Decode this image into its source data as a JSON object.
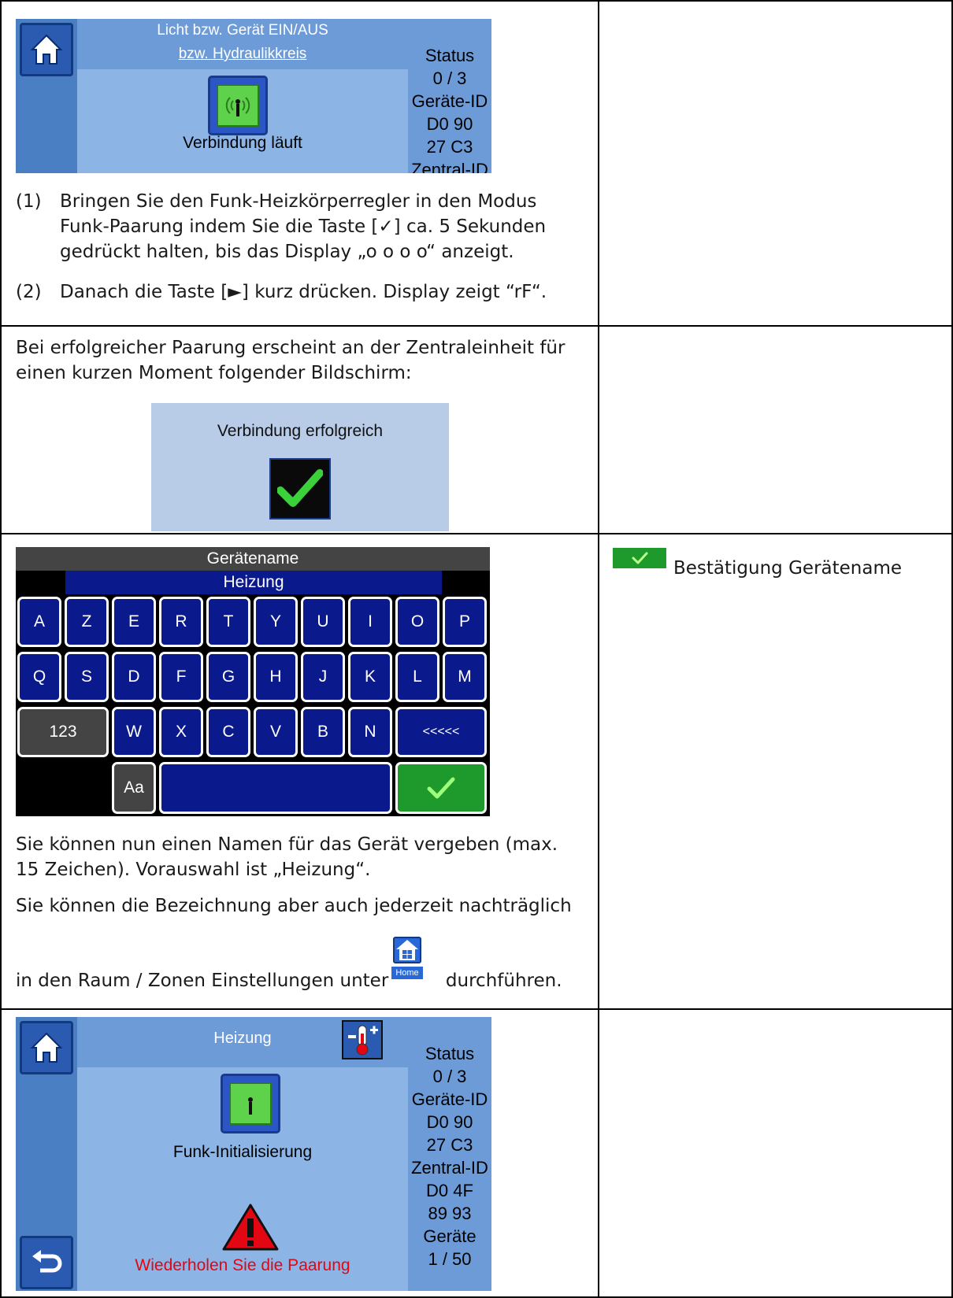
{
  "section1": {
    "screen": {
      "title_line1": "Licht bzw. Gerät EIN/AUS",
      "title_line2": "bzw. Hydraulikkreis",
      "connecting_label": "Verbindung läuft",
      "status_lines": [
        "Status",
        "0 / 3",
        "Geräte-ID",
        "D0 90",
        "27 C3",
        "Zentral-ID"
      ]
    },
    "steps": [
      {
        "num": "(1)",
        "lines": [
          "Bringen Sie den Funk-Heizkörperregler in den Modus",
          "Funk-Paarung indem Sie die Taste [✓] ca. 5 Sekunden",
          "gedrückt halten, bis das Display „o o o o“ anzeigt."
        ]
      },
      {
        "num": "(2)",
        "lines": [
          "Danach die Taste [►] kurz drücken. Display zeigt “rF“."
        ]
      }
    ]
  },
  "section2": {
    "text_lines": [
      "Bei erfolgreicher Paarung erscheint an der Zentraleinheit für",
      "einen kurzen Moment folgender Bildschirm:"
    ],
    "success_label": "Verbindung erfolgreich"
  },
  "section3": {
    "keyboard": {
      "title": "Gerätename",
      "name_value": "Heizung",
      "row1": [
        "A",
        "Z",
        "E",
        "R",
        "T",
        "Y",
        "U",
        "I",
        "O",
        "P"
      ],
      "row2": [
        "Q",
        "S",
        "D",
        "F",
        "G",
        "H",
        "J",
        "K",
        "L",
        "M"
      ],
      "row3": [
        "W",
        "X",
        "C",
        "V",
        "B",
        "N"
      ],
      "num_key": "123",
      "backspace_key": "<<<<<",
      "case_key": "Aa"
    },
    "text_lines": [
      "Sie können nun einen Namen für das Gerät vergeben (max.",
      "15 Zeichen). Vorauswahl ist „Heizung“.",
      "Sie können die Bezeichnung aber auch jederzeit nachträglich"
    ],
    "last_line_before": "in den Raum / Zonen Einstellungen unter",
    "last_line_after": "durchführen.",
    "home_icon_label": "Home",
    "home_icon_digits": "1|2 3|4",
    "right_text": "Bestätigung Gerätename"
  },
  "section4": {
    "screen": {
      "title": "Heizung",
      "init_label": "Funk-Initialisierung",
      "warning_label": "Wiederholen Sie die Paarung",
      "status_lines": [
        "Status",
        "0 / 3",
        "Geräte-ID",
        "D0 90",
        "27 C3",
        "Zentral-ID",
        "D0 4F",
        "89 93",
        "Geräte",
        "1 / 50"
      ]
    }
  },
  "colors": {
    "screen_blue": "#8cb5e6",
    "sidebar_blue": "#4a7fc4",
    "success_green": "#5ed24a",
    "warning_red": "#e30613",
    "keyboard_navy": "#0a1a8c"
  }
}
